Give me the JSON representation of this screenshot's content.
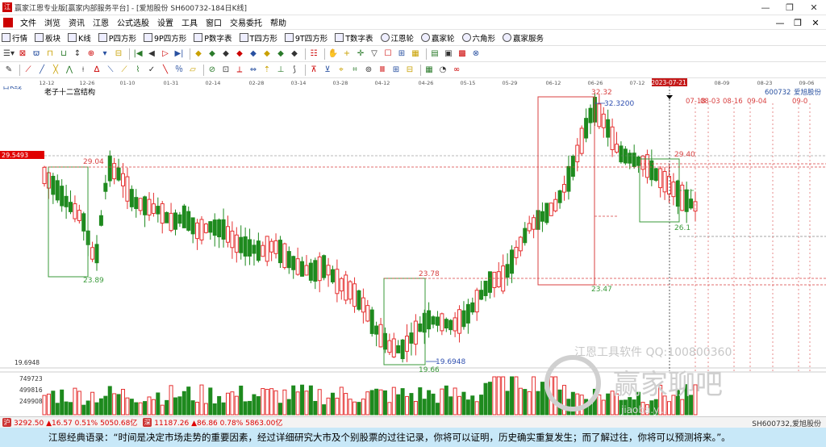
{
  "window": {
    "title": "赢家江恩专业版[赢家内部服务平台] - [爱旭股份  SH600732-184日K线]",
    "icon_label": "江",
    "buttons": [
      "—",
      "❐",
      "✕"
    ]
  },
  "menubar": {
    "items": [
      "文件",
      "浏览",
      "资讯",
      "江恩",
      "公式选股",
      "设置",
      "工具",
      "窗口",
      "交易委托",
      "帮助"
    ],
    "right_buttons": [
      "—",
      "❐",
      "✕"
    ]
  },
  "toolbar1": {
    "items": [
      {
        "label": "行情",
        "icon": "grid-icon"
      },
      {
        "label": "板块",
        "icon": "blocks-icon"
      },
      {
        "label": "K线",
        "icon": "kline-icon"
      },
      {
        "label": "P四方形",
        "icon": "square-icon"
      },
      {
        "label": "9P四方形",
        "icon": "square-icon"
      },
      {
        "label": "P数字表",
        "icon": "table-icon"
      },
      {
        "label": "T四方形",
        "icon": "square-icon"
      },
      {
        "label": "9T四方形",
        "icon": "square-icon"
      },
      {
        "label": "T数字表",
        "icon": "table-icon"
      },
      {
        "label": "江恩轮",
        "icon": "wheel-icon"
      },
      {
        "label": "赢家轮",
        "icon": "wheel-icon"
      },
      {
        "label": "六角形",
        "icon": "hexagon-icon"
      },
      {
        "label": "赢家服务",
        "icon": "service-icon"
      }
    ]
  },
  "toolbar2": {
    "tools": [
      "☰▾",
      "⊠",
      "ϖ",
      "⊓",
      "⊔",
      "↕",
      "⊕",
      "▾",
      "⊟",
      "|◀",
      "◀",
      "▷",
      "▶|",
      "◆",
      "◆",
      "◆",
      "◆",
      "◆",
      "◆",
      "◆",
      "◆",
      "☷",
      "✋",
      "+",
      "✛",
      "▽",
      "☐",
      "⊞",
      "▦",
      "▤",
      "▣",
      "▩",
      "⊗"
    ]
  },
  "toolbar3": {
    "tools": [
      "✎",
      "⟋",
      "╱",
      "╳",
      "⋀",
      "⟊",
      "∆",
      "⟍",
      "⟋",
      "⌇",
      "✓",
      "╲",
      "％",
      "▱",
      "⊘",
      "⊡",
      "⟂",
      "⇔",
      "⇡",
      "⊥",
      "⟆",
      "⊼",
      "⊻",
      "⌖",
      "⌗",
      "⊚",
      "Ⅲ",
      "⊞",
      "⊟",
      "▦",
      "◔",
      "∞"
    ]
  },
  "chart": {
    "period_label": "日K线",
    "study_label": "老子十二宫结构",
    "stock_code": "600732",
    "stock_name": "爱旭股份",
    "current_price_tag": "29.5493",
    "low_axis_label": "19.6948",
    "date_ticks": [
      "12-12",
      "12-26",
      "01-10",
      "01-31",
      "02-14",
      "02-28",
      "03-14",
      "03-28",
      "04-12",
      "04-26",
      "05-15",
      "05-29",
      "06-12",
      "06-26",
      "07-12",
      "2023-07-21",
      "08-09",
      "08-23",
      "09-06"
    ],
    "cursor_date": "2023-07-21",
    "future_dates": [
      "07-18",
      "08-03",
      "08-16",
      "09-04",
      "09-0"
    ],
    "price_labels": [
      "32.32",
      "32.3200",
      "29.04",
      "23.89",
      "23.78",
      "23.47",
      "19.6948",
      "19.66",
      "29.40",
      "26.1"
    ],
    "volume_axis": [
      "749723",
      "499816",
      "249908"
    ],
    "watermark_line1": "江恩工具软件 QQ:100800360",
    "watermark_line2": "赢家聊吧",
    "watermark_line3": "jiaoba.y...",
    "colors": {
      "up": "#e53030",
      "down": "#1e8a1e",
      "box_red": "#d84040",
      "box_green": "#3a9a3a",
      "blue": "#3050b0"
    }
  },
  "chart_data": {
    "type": "candlestick",
    "title": "老子十二宫结构",
    "symbol": "600732 爱旭股份",
    "period": "日K线",
    "x_range": [
      "2022-12-12",
      "2023-09-06"
    ],
    "y_range": [
      19.6948,
      32.32
    ],
    "key_levels": {
      "high": 32.32,
      "low": 19.66,
      "level_29_04": 29.04,
      "level_23_89": 23.89,
      "level_23_78": 23.78,
      "level_23_47": 23.47,
      "level_29_40": 29.4,
      "current": 29.5493
    },
    "close_path": [
      28.5,
      27.8,
      27.0,
      26.4,
      24.2,
      28.9,
      28.5,
      27.2,
      27.0,
      26.8,
      26.2,
      26.5,
      25.8,
      26.0,
      25.9,
      25.2,
      25.0,
      24.8,
      25.1,
      24.5,
      24.0,
      23.8,
      24.1,
      23.3,
      22.9,
      22.2,
      21.0,
      20.2,
      20.0,
      20.8,
      21.5,
      21.4,
      21.2,
      21.6,
      22.5,
      23.4,
      23.5,
      24.8,
      26.0,
      26.5,
      27.0,
      28.2,
      30.0,
      31.8,
      31.0,
      29.6,
      29.3,
      29.1,
      28.5,
      28.0,
      27.4,
      27.0
    ]
  },
  "status": {
    "index1_icon": "沪",
    "index1": "3292.50 ▲16.57 0.51% 5050.68亿",
    "index2_icon": "深",
    "index2": "11187.26 ▲86.86 0.78% 5863.00亿",
    "right": "SH600732,爱旭股份"
  },
  "quote": "江恩经典语录：“时间是决定市场走势的重要因素，经过详细研究大市及个别股票的过往记录，你将可以证明，历史确实重复发生；而了解过往，你将可以预测将来。”。"
}
